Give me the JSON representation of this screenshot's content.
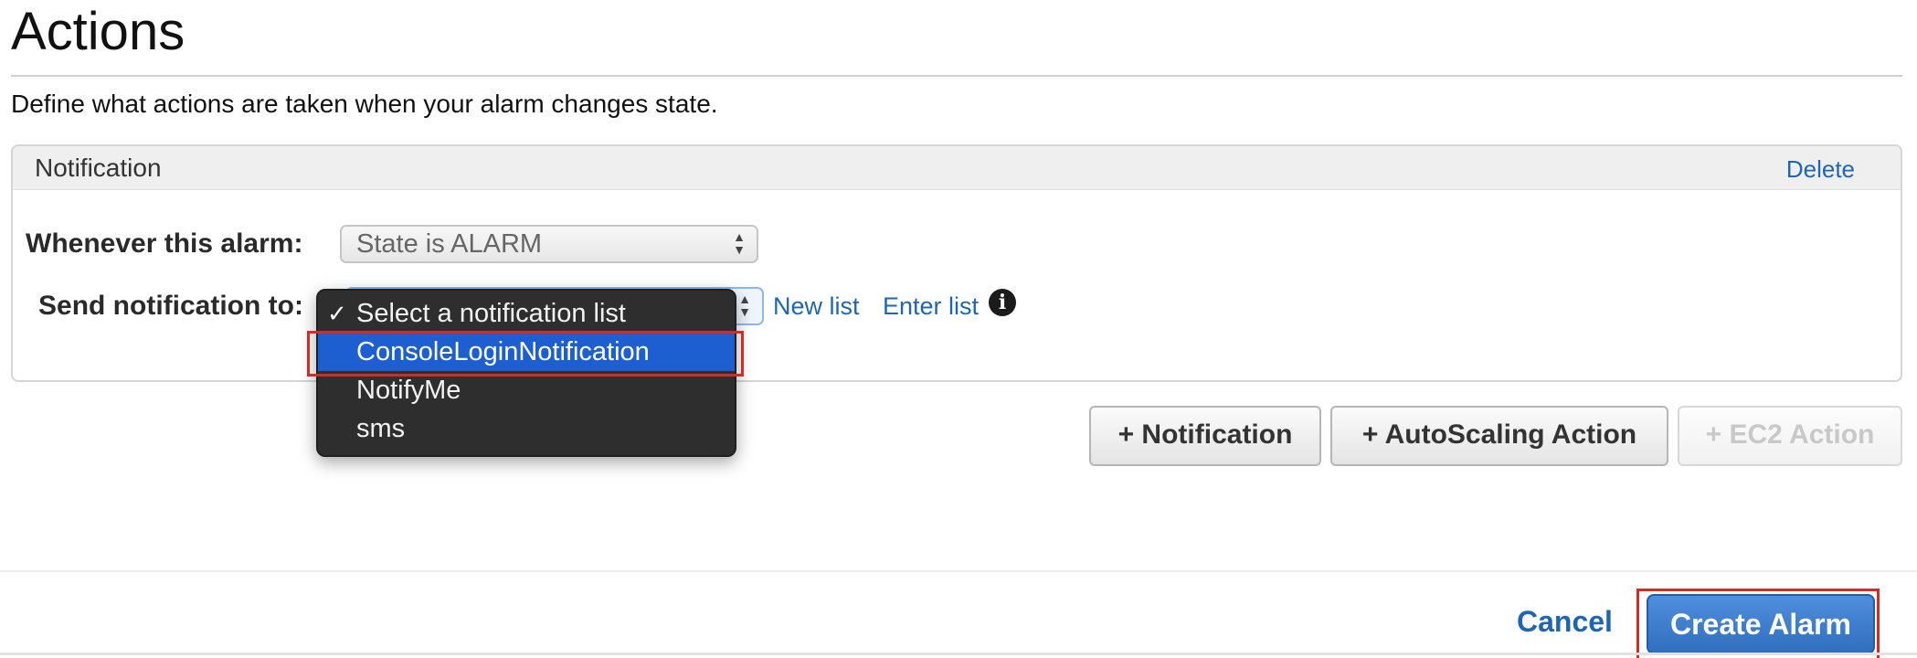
{
  "header": {
    "title": "Actions",
    "description": "Define what actions are taken when your alarm changes state."
  },
  "notification_panel": {
    "title": "Notification",
    "delete_label": "Delete",
    "whenever_label": "Whenever this alarm:",
    "whenever_value": "State is ALARM",
    "send_label": "Send notification to:",
    "new_list_label": "New list",
    "enter_list_label": "Enter list",
    "info_icon": "info-icon"
  },
  "dropdown": {
    "items": [
      {
        "label": "Select a notification list",
        "checked": true
      },
      {
        "label": "ConsoleLoginNotification",
        "selected": true
      },
      {
        "label": "NotifyMe"
      },
      {
        "label": "sms"
      }
    ]
  },
  "action_buttons": {
    "notification": "+ Notification",
    "autoscaling": "+ AutoScaling Action",
    "ec2": "+ EC2 Action"
  },
  "footer": {
    "cancel_label": "Cancel",
    "create_label": "Create Alarm"
  },
  "colors": {
    "link": "#1e66b4",
    "primary_button": "#2f6fbd",
    "highlight": "#d42b22",
    "dropdown_selected": "#1d5fd0"
  }
}
